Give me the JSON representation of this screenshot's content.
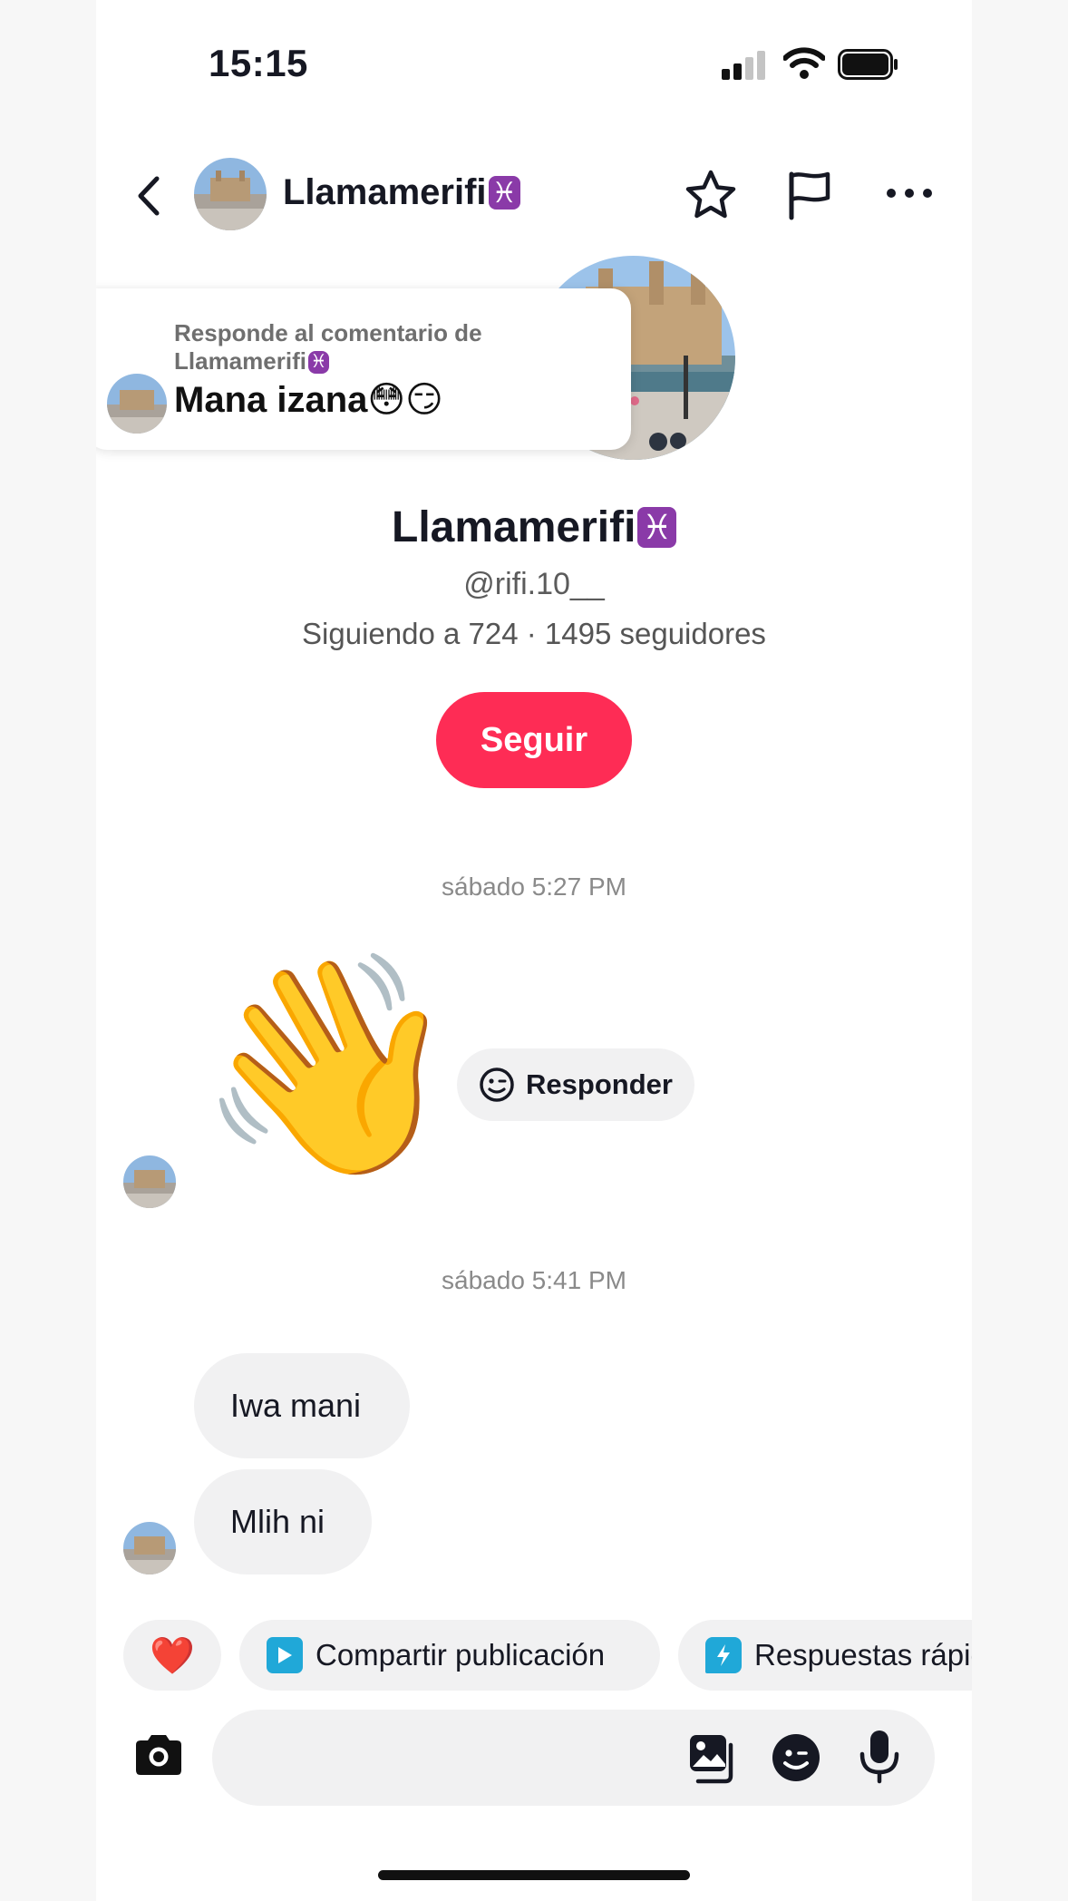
{
  "status_bar": {
    "time": "15:15"
  },
  "header": {
    "back_icon": "chevron-left-icon",
    "name": "Llamamerifi",
    "zodiac": "♓",
    "star_icon": "star-outline-icon",
    "flag_icon": "flag-outline-icon",
    "more_icon": "more-horizontal-icon"
  },
  "reply_card": {
    "caption": "Responde al comentario de Llamamerifi",
    "zodiac": "♓",
    "text": "Mana izana😳😏"
  },
  "profile": {
    "name": "Llamamerifi",
    "zodiac": "♓",
    "handle": "@rifi.10__",
    "stats": "Siguiendo a 724 · 1495 seguidores",
    "follow_label": "Seguir"
  },
  "messages": [
    {
      "timestamp": "sábado 5:27 PM",
      "emoji": "👋",
      "reply_label": "Responder"
    },
    {
      "timestamp": "sábado 5:41 PM",
      "bubbles": [
        "Iwa mani",
        "Mlih ni"
      ]
    }
  ],
  "quick_actions": {
    "heart": "❤️",
    "share_post": "Compartir publicación",
    "quick_replies": "Respuestas rápidas"
  },
  "input": {
    "placeholder": "",
    "camera_icon": "camera-icon",
    "gallery_icon": "gallery-icon",
    "sticker_icon": "sticker-icon",
    "mic_icon": "microphone-icon"
  },
  "colors": {
    "accent": "#fe2c55",
    "bubble": "#f1f1f2",
    "zodiac": "#8a3aa8",
    "chip_icon": "#20a8d8"
  }
}
